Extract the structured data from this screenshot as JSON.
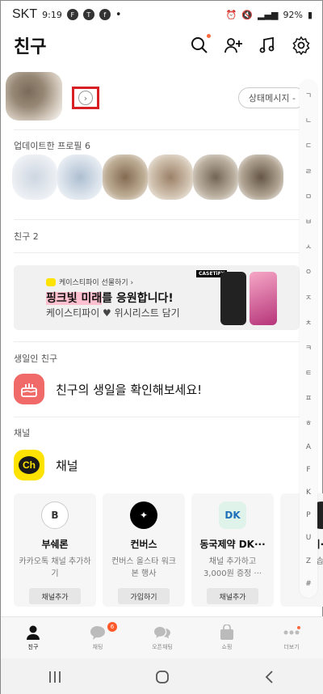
{
  "status_bar": {
    "carrier": "SKT",
    "time": "9:19",
    "battery": "92%"
  },
  "header": {
    "title": "친구"
  },
  "profile": {
    "status_button_label": "상태메시지 -"
  },
  "updated_profiles": {
    "label": "업데이트한 프로필 6"
  },
  "friends": {
    "count_label": "친구 2"
  },
  "ad": {
    "brand": "케이스티파이 선물하기 ›",
    "headline_highlight": "핑크빛 미래",
    "headline_rest": "를 응원합니다!",
    "sub": "케이스티파이 ♥ 위시리스트 담기",
    "case_tag": "CASETiFY"
  },
  "birthday": {
    "section_label": "생일인 친구",
    "text": "친구의 생일을 확인해보세요!"
  },
  "channel": {
    "section_label": "채널",
    "title": "채널",
    "icon_text": "Ch",
    "cards": [
      {
        "name": "부쉐론",
        "desc": "카카오톡 채널 추가하기",
        "button": "채널추가",
        "logo": "B"
      },
      {
        "name": "컨버스",
        "desc": "컨버스 올스타 워크 본 행사",
        "button": "가입하기",
        "logo": "✦"
      },
      {
        "name": "동국제약 DK···",
        "desc": "채널 추가하고 3,000원 증정 ···",
        "button": "채널추가",
        "logo": "DK"
      },
      {
        "name": "이···",
        "desc": "이솝 ···",
        "button": "",
        "logo": ""
      }
    ]
  },
  "index_letters": [
    "ㄱ",
    "ㄴ",
    "ㄷ",
    "ㄹ",
    "ㅁ",
    "ㅂ",
    "ㅅ",
    "ㅇ",
    "ㅈ",
    "ㅊ",
    "ㅋ",
    "ㅌ",
    "ㅍ",
    "ㅎ",
    "A",
    "F",
    "K",
    "P",
    "U",
    "Z",
    "#"
  ],
  "tabs": [
    {
      "label": "친구",
      "badge": ""
    },
    {
      "label": "채팅",
      "badge": "6"
    },
    {
      "label": "오픈채팅",
      "badge": ""
    },
    {
      "label": "쇼핑",
      "badge": ""
    },
    {
      "label": "더보기",
      "badge": ""
    }
  ]
}
